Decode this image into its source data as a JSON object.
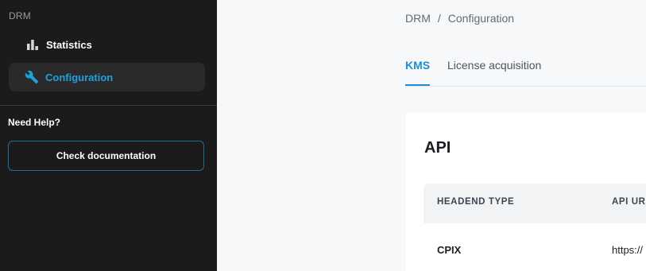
{
  "sidebar": {
    "section_label": "DRM",
    "items": [
      {
        "label": "Statistics",
        "icon": "bar-chart-icon"
      },
      {
        "label": "Configuration",
        "icon": "wrench-icon",
        "active": true
      }
    ],
    "help_title": "Need Help?",
    "doc_button": "Check documentation"
  },
  "breadcrumb": {
    "root": "DRM",
    "separator": "/",
    "current": "Configuration"
  },
  "tabs": [
    {
      "label": "KMS",
      "active": true
    },
    {
      "label": "License acquisition",
      "active": false
    }
  ],
  "card": {
    "title": "API",
    "columns": [
      "HEADEND TYPE",
      "API URI"
    ],
    "rows": [
      {
        "headend_type": "CPIX",
        "api_url": "https://"
      }
    ]
  },
  "colors": {
    "sidebar_bg": "#1b1b1b",
    "accent": "#1d8fd0",
    "page_bg": "#f7f8fa"
  }
}
